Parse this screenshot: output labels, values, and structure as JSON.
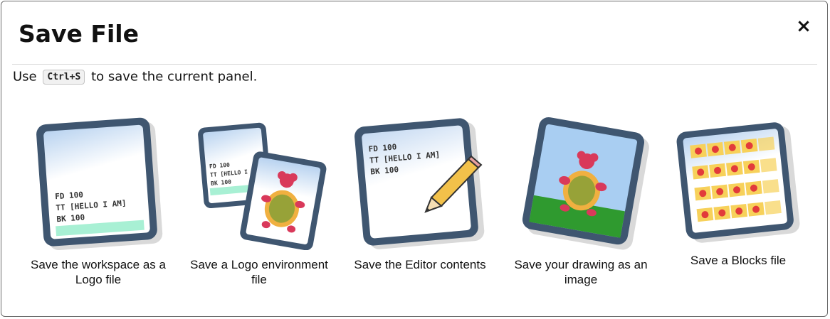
{
  "dialog": {
    "title": "Save File",
    "close_symbol": "×",
    "hint": {
      "prefix": "Use",
      "shortcut": "Ctrl+S",
      "suffix": "to save the current panel."
    }
  },
  "options": [
    {
      "label": "Save the workspace as a Logo file",
      "icon": "logo-file-icon",
      "code": [
        "FD 100",
        "TT [HELLO I AM]",
        "BK 100"
      ]
    },
    {
      "label": "Save a Logo environment file",
      "icon": "environment-file-icon",
      "code": [
        "FD 100",
        "TT [HELLO I",
        "BK 100"
      ]
    },
    {
      "label": "Save the Editor contents",
      "icon": "editor-file-icon",
      "code": [
        "FD 100",
        "TT [HELLO I AM]",
        "BK 100"
      ]
    },
    {
      "label": "Save your drawing as an image",
      "icon": "drawing-image-icon"
    },
    {
      "label": "Save a Blocks file",
      "icon": "blocks-file-icon"
    }
  ],
  "colors": {
    "frame": "#3f5670",
    "paper": "#ffffff",
    "paper_gradient": "#b9d3f0",
    "highlight": "#a8f0d4",
    "sky": "#a9cef2",
    "grass": "#2f9a2f",
    "turtle_red": "#d9395a",
    "turtle_green": "#5c9a34",
    "turtle_orange": "#f0b040",
    "block_yellow": "#f7d15a",
    "block_red": "#e23b3b"
  }
}
